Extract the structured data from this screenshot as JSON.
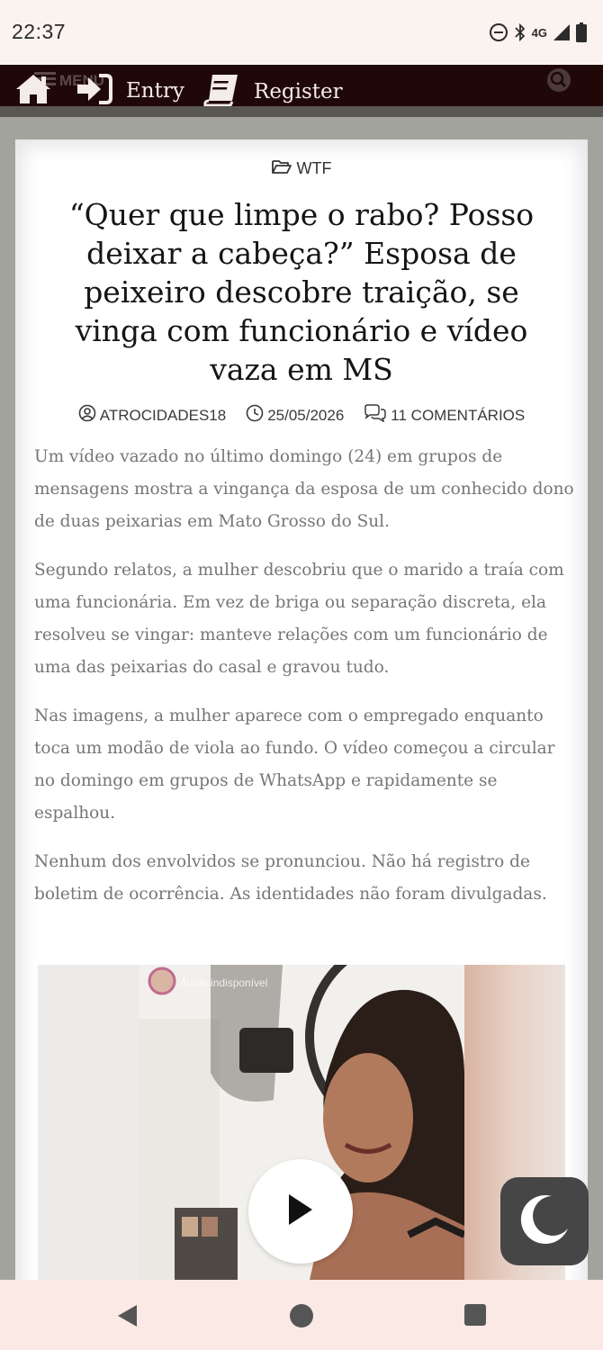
{
  "status_bar": {
    "time": "22:37",
    "network": "4G"
  },
  "header": {
    "menu_label": "MENU",
    "entry_label": "Entry",
    "register_label": "Register"
  },
  "article": {
    "category": "WTF",
    "title": "“Quer que limpe o rabo? Posso deixar a cabeça?” Esposa de peixeiro descobre traição, se vinga com funcionário e vídeo vaza em MS",
    "author": "ATROCIDADES18",
    "date": "25/05/2026",
    "comments": "11 COMENTÁRIOS",
    "paragraphs": [
      "Um vídeo vazado no último domingo (24) em grupos de mensagens mostra a vingança da esposa de um conhecido dono de duas peixarias em Mato Grosso do Sul.",
      "Segundo relatos, a mulher descobriu que o marido a traía com uma funcionária. Em vez de briga ou separação discreta, ela resolveu se vingar: manteve relações com um funcionário de uma das peixarias do casal e gravou tudo.",
      "Nas imagens, a mulher aparece com o empregado enquanto toca um modão de viola ao fundo. O vídeo começou a circular no domingo em grupos de WhatsApp e rapidamente se espalhou.",
      "Nenhum dos envolvidos se pronunciou. Não há registro de boletim de ocorrência. As identidades não foram divulgadas."
    ]
  },
  "video": {
    "overlay_text": "Áudio indisponível"
  },
  "colors": {
    "header_bg": "#210808",
    "page_bg": "#a3a39e",
    "body_text": "#767676",
    "dark_toggle_bg": "#464646"
  },
  "icons": [
    "home-icon",
    "sign-in-icon",
    "book-icon",
    "search-icon",
    "folder-icon",
    "user-icon",
    "clock-icon",
    "comments-icon",
    "play-icon",
    "moon-icon"
  ]
}
